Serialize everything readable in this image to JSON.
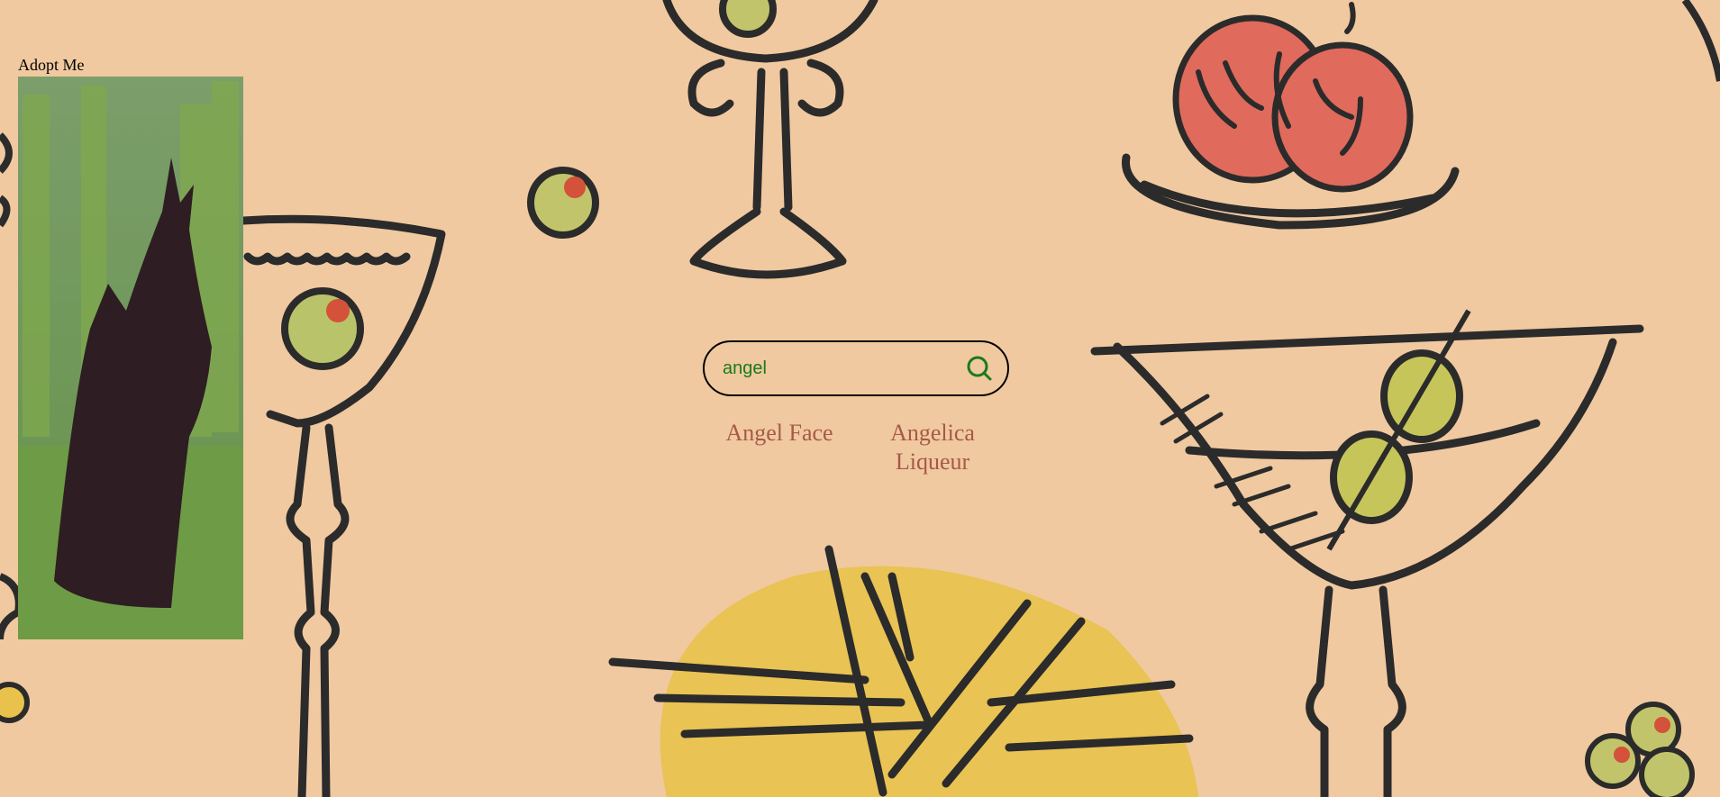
{
  "colors": {
    "background": "#f0c9a0",
    "search_text": "#1a7a1a",
    "search_icon": "#1a7a1a",
    "result_link": "#a65a47",
    "ink": "#2b2b2b"
  },
  "adopt": {
    "label": "Adopt Me",
    "image": "scottish-terrier-photo"
  },
  "search": {
    "value": "angel",
    "icon": "search-icon"
  },
  "results": [
    {
      "label": "Angel Face"
    },
    {
      "label": "Angelica Liqueur"
    }
  ]
}
